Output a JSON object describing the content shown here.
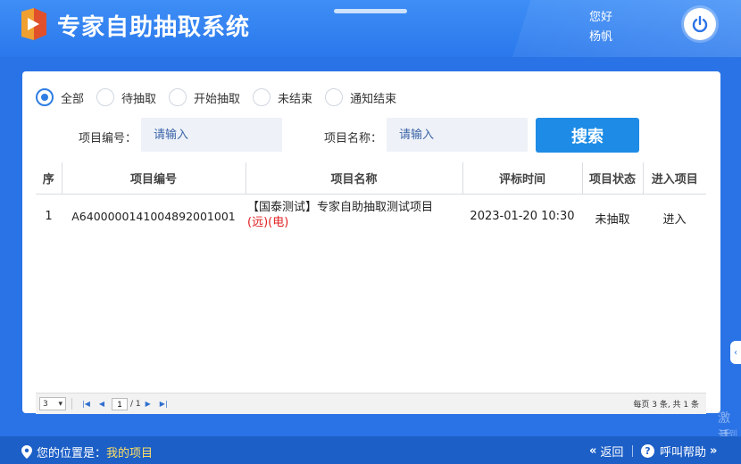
{
  "app": {
    "title": "专家自助抽取系统"
  },
  "header": {
    "greeting": "您好",
    "username": "杨帆"
  },
  "filters": [
    {
      "label": "全部",
      "checked": true
    },
    {
      "label": "待抽取",
      "checked": false
    },
    {
      "label": "开始抽取",
      "checked": false
    },
    {
      "label": "未结束",
      "checked": false
    },
    {
      "label": "通知结束",
      "checked": false
    }
  ],
  "search": {
    "code_label": "项目编号：",
    "code_placeholder": "请输入",
    "name_label": "项目名称：",
    "name_placeholder": "请输入",
    "button_label": "搜索"
  },
  "table": {
    "headers": [
      "序",
      "项目编号",
      "项目名称",
      "评标时间",
      "项目状态",
      "进入项目"
    ],
    "rows": [
      {
        "index": "1",
        "code": "A6400000141004892001001",
        "name": "【国泰测试】专家自助抽取测试项目",
        "tags": "(远)(电)",
        "time": "2023-01-20 10:30",
        "status": "未抽取",
        "action": "进入"
      }
    ]
  },
  "pager": {
    "page_size": "3",
    "current_page": "1",
    "total_pages": "/ 1",
    "summary": "每页 3 条, 共 1 条"
  },
  "watermark": {
    "line1": "激活",
    "line2": "转到"
  },
  "footer": {
    "location_label": "您的位置是：",
    "location_link": "我的项目",
    "back_label": "返回",
    "help_label": "呼叫帮助"
  }
}
